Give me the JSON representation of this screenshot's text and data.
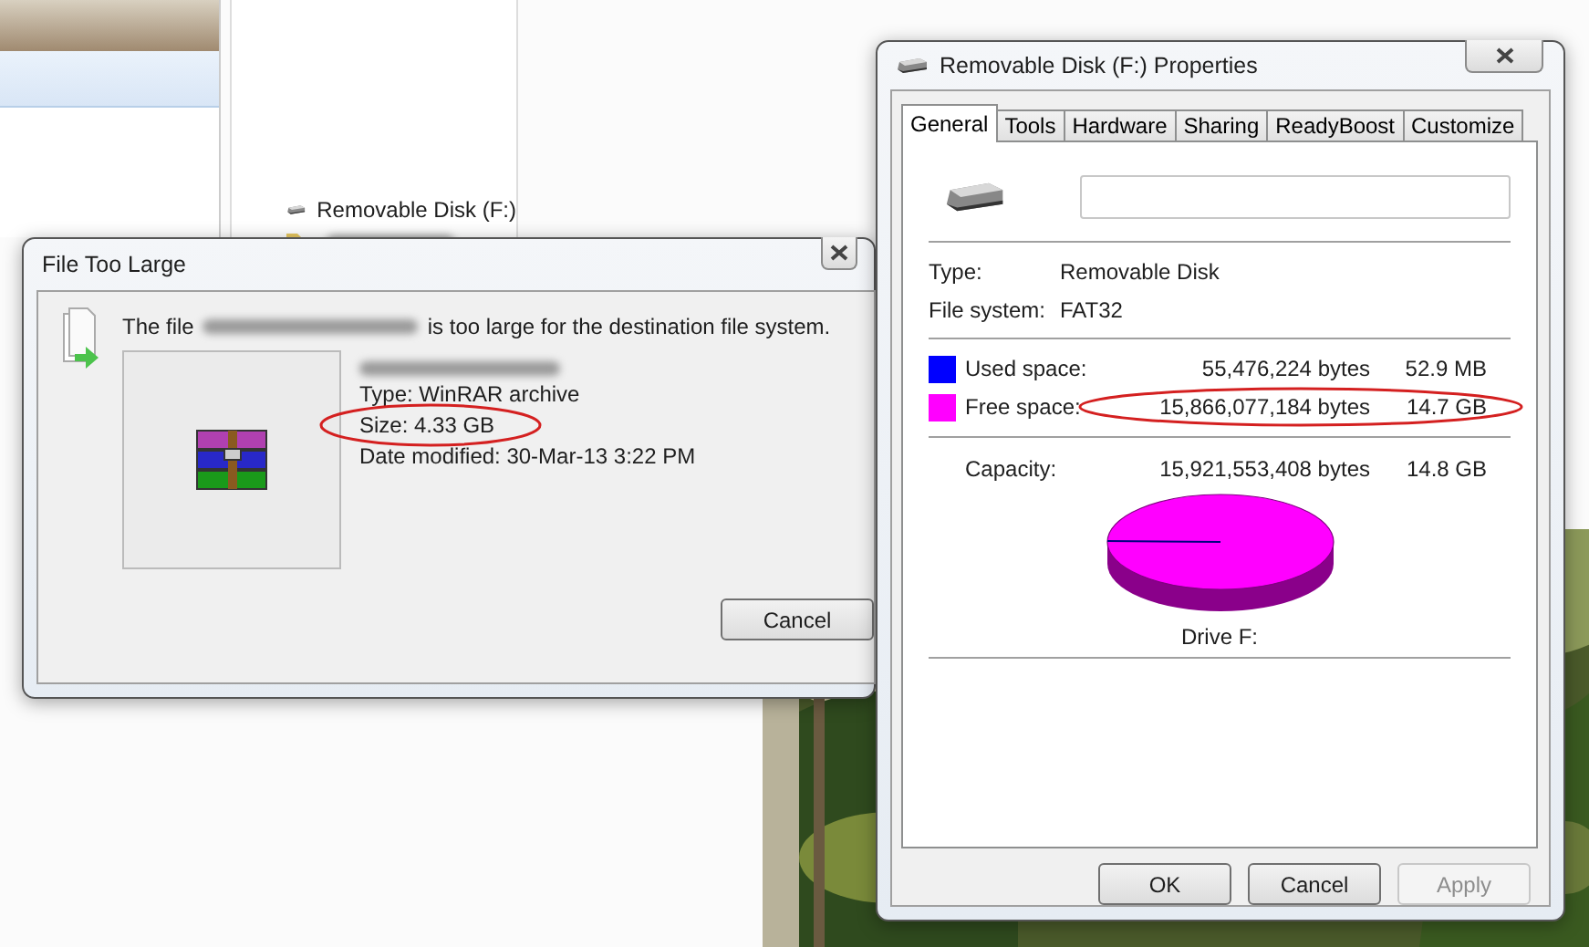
{
  "explorer": {
    "nav_items": [
      {
        "label": "Removable Disk (F:)",
        "kind": "drive"
      },
      {
        "kind": "blurred-folder"
      }
    ]
  },
  "file_dialog": {
    "title": "File Too Large",
    "message_start": "The file",
    "message_end": "is too large for the destination file system.",
    "details": [
      {
        "text": "Type: WinRAR archive",
        "circled": false
      },
      {
        "text": "Size: 4.33 GB",
        "circled": true
      },
      {
        "text": "Date modified: 30-Mar-13 3:22 PM",
        "circled": false
      }
    ],
    "buttons": [
      {
        "label": "Cancel"
      }
    ]
  },
  "properties": {
    "title": "Removable Disk (F:) Properties",
    "tabs": [
      {
        "label": "General",
        "selected": true
      },
      {
        "label": "Tools",
        "selected": false
      },
      {
        "label": "Hardware",
        "selected": false
      },
      {
        "label": "Sharing",
        "selected": false
      },
      {
        "label": "ReadyBoost",
        "selected": false
      },
      {
        "label": "Customize",
        "selected": false
      }
    ],
    "info": [
      {
        "label": "Type:",
        "value": "Removable Disk"
      },
      {
        "label": "File system:",
        "value": "FAT32"
      }
    ],
    "space": [
      {
        "label": "Used space:",
        "bytes": "55,476,224 bytes",
        "size": "52.9 MB",
        "color": "#0000ff",
        "circled": false
      },
      {
        "label": "Free space:",
        "bytes": "15,866,077,184 bytes",
        "size": "14.7 GB",
        "color": "#ff00ff",
        "circled": true
      }
    ],
    "capacity": {
      "label": "Capacity:",
      "bytes": "15,921,553,408 bytes",
      "size": "14.8 GB"
    },
    "chart_caption": "Drive F:",
    "buttons": [
      {
        "label": "OK",
        "disabled": false
      },
      {
        "label": "Cancel",
        "disabled": false
      },
      {
        "label": "Apply",
        "disabled": true
      }
    ]
  }
}
